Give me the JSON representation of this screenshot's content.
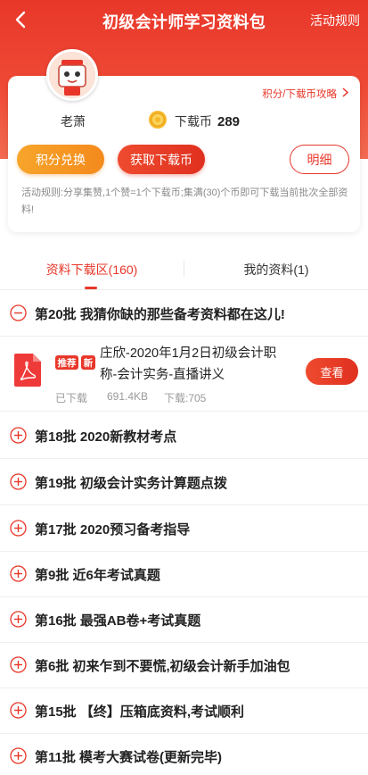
{
  "header": {
    "title": "初级会计师学习资料包",
    "rules_link": "活动规则"
  },
  "profile": {
    "strategy_link": "积分/下载币攻略",
    "username": "老萧",
    "coin_label": "下载币",
    "coin_count": "289"
  },
  "actions": {
    "exchange": "积分兑换",
    "get_coins": "获取下载币",
    "detail": "明细"
  },
  "activity_rules": "活动规则:分享集赞,1个赞=1个下载币;集满(30)个币即可下载当前批次全部资料!",
  "tabs": {
    "download_area": "资料下载区(160)",
    "my_materials": "我的资料(1)"
  },
  "batches": [
    {
      "label": "第20批 我猜你缺的那些备考资料都在这儿!",
      "expanded": true
    },
    {
      "label": "第18批 2020新教材考点",
      "expanded": false
    },
    {
      "label": "第19批 初级会计实务计算题点拨",
      "expanded": false
    },
    {
      "label": "第17批 2020预习备考指导",
      "expanded": false
    },
    {
      "label": "第9批 近6年考试真题",
      "expanded": false
    },
    {
      "label": "第16批 最强AB卷+考试真题",
      "expanded": false
    },
    {
      "label": "第6批 初来乍到不要慌,初级会计新手加油包",
      "expanded": false
    },
    {
      "label": "第15批 【终】压箱底资料,考试顺利",
      "expanded": false
    },
    {
      "label": "第11批 模考大赛试卷(更新完毕)",
      "expanded": false
    }
  ],
  "file": {
    "tag_recommend": "推荐",
    "tag_new": "新",
    "title_line1": "庄欣-2020年1月2日初级会计职",
    "title_line2": "称-会计实务-直播讲义",
    "status": "已下载",
    "size": "691.4KB",
    "downloads": "下载:705",
    "view_button": "查看"
  },
  "colors": {
    "brand_red": "#e8372a",
    "orange": "#f48a1c",
    "muted_text": "#9a9a9a"
  }
}
